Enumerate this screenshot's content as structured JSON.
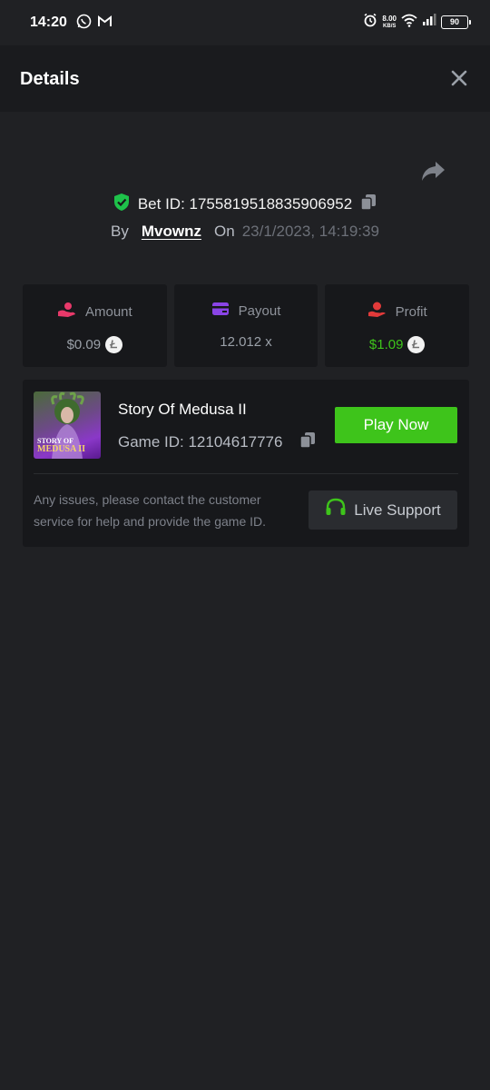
{
  "status_bar": {
    "time": "14:20",
    "net_speed_value": "8.00",
    "net_speed_unit": "KB/S",
    "battery": "90",
    "icons": [
      "whatsapp-icon",
      "gmail-icon",
      "alarm-icon",
      "wifi-icon",
      "signal-icon",
      "battery-icon"
    ]
  },
  "header": {
    "title": "Details"
  },
  "bet": {
    "id_label": "Bet ID: 1755819518835906952",
    "by_label": "By",
    "username": "Mvownz",
    "on_label": "On",
    "date": "23/1/2023, 14:19:39"
  },
  "stats": [
    {
      "label": "Amount",
      "value": "$0.09",
      "icon": "hand-coins-icon",
      "icon_color": "#e8396a"
    },
    {
      "label": "Payout",
      "value": "12.012 x",
      "icon": "card-icon",
      "icon_color": "#8a44e6"
    },
    {
      "label": "Profit",
      "value": "$1.09",
      "icon": "hand-money-icon",
      "icon_color": "#e23a3a"
    }
  ],
  "game": {
    "name": "Story Of Medusa II",
    "id_label": "Game ID: 12104617776",
    "thumb_title_line1": "STORY OF",
    "thumb_title_line2": "MEDUSA II",
    "play_label": "Play Now",
    "issue_text": "Any issues, please contact the customer service for help and provide the game ID.",
    "support_label": "Live Support"
  },
  "colors": {
    "accent_green": "#3ec41b",
    "background": "#202124",
    "card": "#17181b"
  }
}
